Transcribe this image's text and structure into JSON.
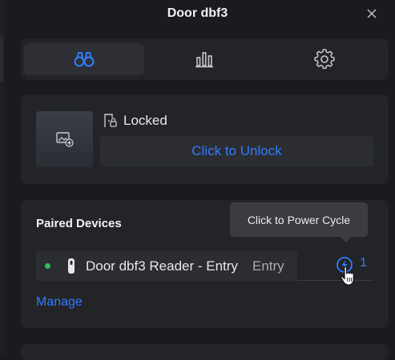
{
  "window": {
    "title": "Door dbf3"
  },
  "tabs": [
    {
      "icon": "binoculars-icon",
      "active": true
    },
    {
      "icon": "bar-chart-icon",
      "active": false
    },
    {
      "icon": "gear-icon",
      "active": false
    }
  ],
  "lock": {
    "status": "Locked",
    "unlock_label": "Click to Unlock"
  },
  "paired": {
    "title": "Paired Devices",
    "devices": [
      {
        "name": "Door dbf3 Reader - Entry",
        "direction": "Entry",
        "status_color": "#2cc062",
        "power_cycle_count": "1"
      }
    ],
    "manage_label": "Manage"
  },
  "tooltip": {
    "text": "Click to Power Cycle"
  },
  "colors": {
    "accent": "#2f7dff",
    "background": "#1a1b1e",
    "card": "#232428",
    "online": "#2cc062"
  }
}
